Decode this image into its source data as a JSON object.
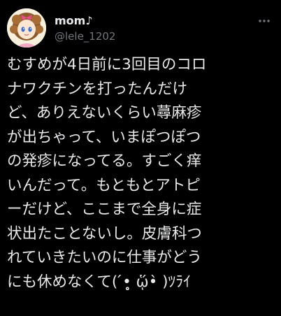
{
  "tweet": {
    "display_name": "mom♪",
    "handle": "@lele_1202",
    "more_icon": "more-horizontal-icon",
    "lines": [
      "むすめが4日前に3回目のコロ",
      "ナワクチンを打ったんだけ",
      "ど、ありえないくらい蕁麻疹",
      "が出ちゃって、いまぽつぽつ",
      "の発疹になってる。すごく痒",
      "いんだって。もともとアトピ",
      "ーだけど、ここまで全身に症",
      "状出たことないし。皮膚科つ",
      "れていきたいのに仕事がどう",
      "にも休めなくて( ́•̥̥̥ ᾥ•̀ )ﾂﾗｲ"
    ]
  },
  "colors": {
    "background": "#000000",
    "text": "#e7e9ea",
    "secondary": "#71767b"
  }
}
